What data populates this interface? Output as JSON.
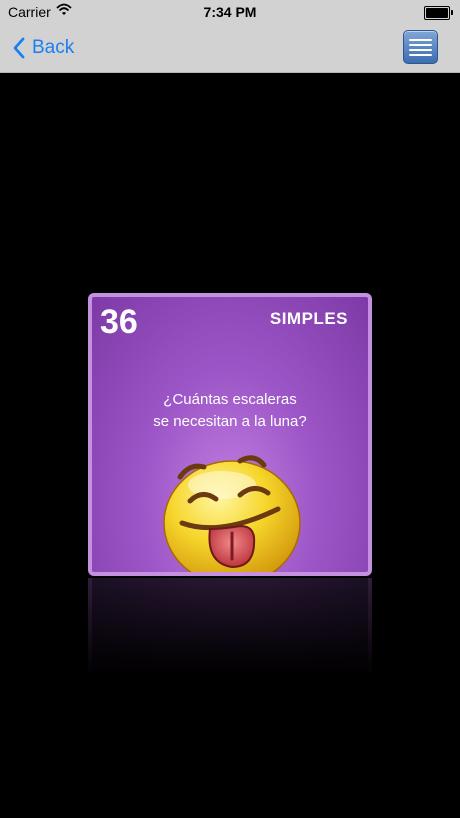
{
  "status_bar": {
    "carrier": "Carrier",
    "time": "7:34 PM"
  },
  "nav": {
    "back_label": "Back",
    "menu_icon": "list-menu-icon"
  },
  "card": {
    "number": "36",
    "category": "SIMPLES",
    "question_line1": "¿Cuántas escaleras",
    "question_line2": "se necesitan a la luna?",
    "image_icon": "tongue-out-emoji-icon"
  },
  "colors": {
    "accent": "#1a7ff0",
    "card_purple": "#9d56c7",
    "card_border": "#c590df",
    "background": "#000000"
  }
}
